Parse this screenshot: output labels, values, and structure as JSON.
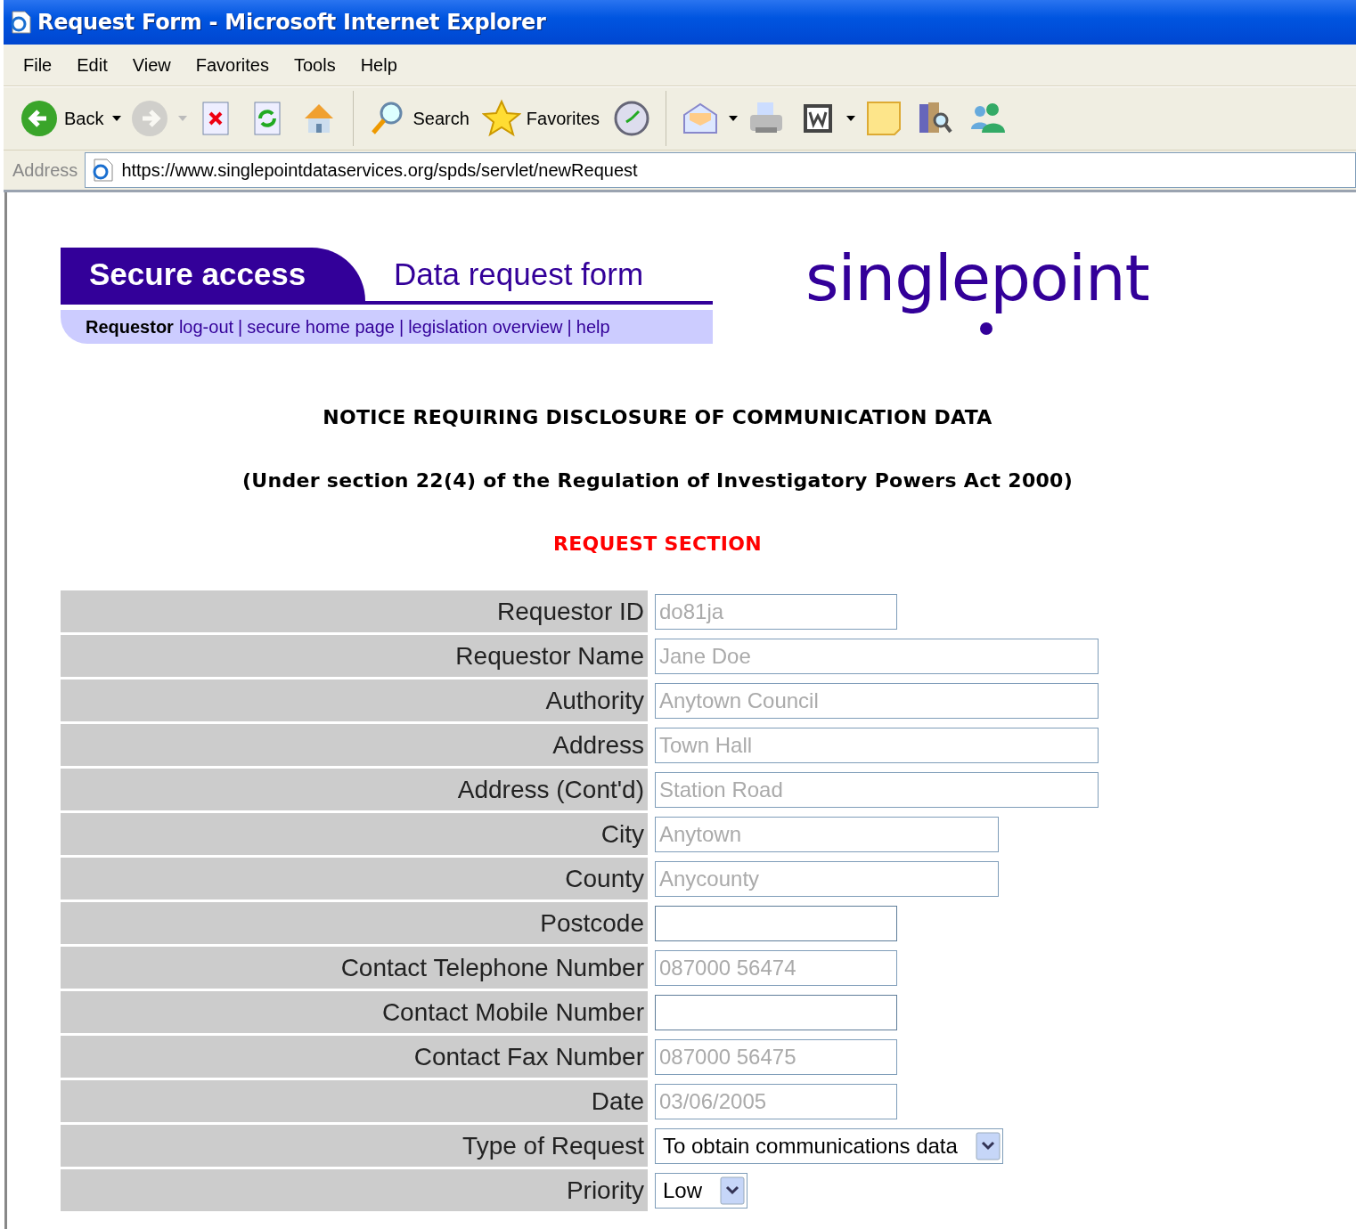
{
  "window": {
    "title": "Request Form - Microsoft Internet Explorer"
  },
  "menu": [
    "File",
    "Edit",
    "View",
    "Favorites",
    "Tools",
    "Help"
  ],
  "toolbar": [
    {
      "kind": "back",
      "label": "Back",
      "dropdown": true,
      "disabled": false
    },
    {
      "kind": "forward",
      "dropdown": true,
      "disabled": true
    },
    {
      "kind": "stop",
      "disabled": false
    },
    {
      "kind": "refresh",
      "disabled": false
    },
    {
      "kind": "home",
      "disabled": false
    },
    {
      "kind": "separator"
    },
    {
      "kind": "search",
      "label": "Search",
      "disabled": false
    },
    {
      "kind": "favorites",
      "label": "Favorites",
      "disabled": false
    },
    {
      "kind": "history",
      "disabled": false
    },
    {
      "kind": "separator"
    },
    {
      "kind": "mail",
      "dropdown": true,
      "disabled": false
    },
    {
      "kind": "print",
      "disabled": false
    },
    {
      "kind": "edit",
      "dropdown": true,
      "disabled": false
    },
    {
      "kind": "note",
      "disabled": false
    },
    {
      "kind": "research",
      "disabled": false
    },
    {
      "kind": "messenger",
      "disabled": false
    }
  ],
  "address": {
    "label": "Address",
    "url": "https://www.singlepointdataservices.org/spds/servlet/newRequest"
  },
  "header": {
    "tab": "Secure access",
    "title": "Data request form",
    "user": "Requestor",
    "separator": "|",
    "links": [
      "log-out",
      "secure home page",
      "legislation overview",
      "help"
    ],
    "logo": "singlepoint"
  },
  "notice": {
    "title": "NOTICE REQUIRING DISCLOSURE OF COMMUNICATION DATA",
    "subtitle": "(Under section 22(4) of the Regulation of Investigatory Powers Act 2000)",
    "section": "REQUEST SECTION"
  },
  "form": [
    {
      "label": "Requestor ID",
      "kind": "short",
      "value": "do81ja",
      "disabled": true
    },
    {
      "label": "Requestor Name",
      "kind": "long",
      "value": "Jane Doe",
      "disabled": true
    },
    {
      "label": "Authority",
      "kind": "long",
      "value": "Anytown Council",
      "disabled": true
    },
    {
      "label": "Address",
      "kind": "long",
      "value": "Town Hall",
      "disabled": true
    },
    {
      "label": "Address (Cont'd)",
      "kind": "long",
      "value": "Station Road",
      "disabled": true
    },
    {
      "label": "City",
      "kind": "medium",
      "value": "Anytown",
      "disabled": true
    },
    {
      "label": "County",
      "kind": "medium",
      "value": "Anycounty",
      "disabled": true
    },
    {
      "label": "Postcode",
      "kind": "short",
      "disabled": false
    },
    {
      "label": "Contact Telephone Number",
      "kind": "short",
      "value": "087000 56474",
      "disabled": true
    },
    {
      "label": "Contact Mobile Number",
      "kind": "short",
      "disabled": false
    },
    {
      "label": "Contact Fax Number",
      "kind": "short",
      "value": "087000 56475",
      "disabled": true
    },
    {
      "label": "Date",
      "kind": "short",
      "value": "03/06/2005",
      "disabled": true
    },
    {
      "label": "Type of Request",
      "kind": "select",
      "value": "To obtain communications data",
      "disabled": false
    },
    {
      "label": "Priority",
      "kind": "select",
      "value": "Low",
      "disabled": false
    }
  ]
}
